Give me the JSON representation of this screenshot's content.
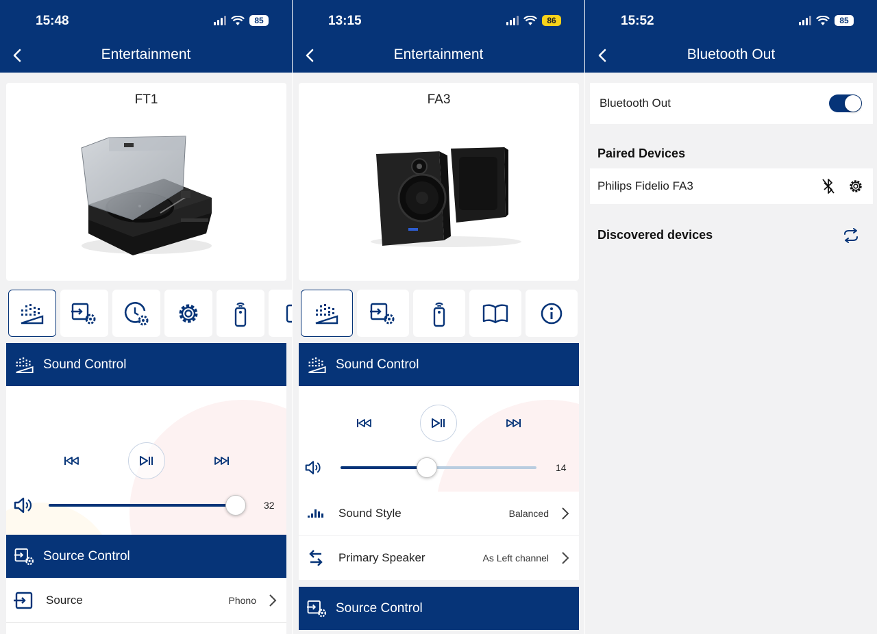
{
  "screens": [
    {
      "status": {
        "time": "15:48",
        "battery": "85"
      },
      "header": {
        "title": "Entertainment"
      },
      "device": {
        "name": "FT1",
        "image": "turntable"
      },
      "tabs": [
        {
          "icon": "sound-control-icon",
          "active": true
        },
        {
          "icon": "source-control-icon",
          "active": false
        },
        {
          "icon": "timer-settings-icon",
          "active": false
        },
        {
          "icon": "gear-icon",
          "active": false
        },
        {
          "icon": "remote-icon",
          "active": false
        },
        {
          "icon": "more-icon",
          "active": false
        }
      ],
      "sound_control": {
        "title": "Sound Control",
        "volume": "32",
        "volume_level": 1.0
      },
      "source_control": {
        "title": "Source Control"
      },
      "source_row": {
        "label": "Source",
        "value": "Phono"
      }
    },
    {
      "status": {
        "time": "13:15",
        "battery": "86"
      },
      "header": {
        "title": "Entertainment"
      },
      "device": {
        "name": "FA3",
        "image": "speakers"
      },
      "tabs": [
        {
          "icon": "sound-control-icon",
          "active": true
        },
        {
          "icon": "source-control-icon",
          "active": false
        },
        {
          "icon": "remote-icon",
          "active": false
        },
        {
          "icon": "book-icon",
          "active": false
        },
        {
          "icon": "info-icon",
          "active": false
        }
      ],
      "sound_control": {
        "title": "Sound Control",
        "volume": "14",
        "volume_level": 0.44
      },
      "settings": [
        {
          "icon": "equalizer-icon",
          "label": "Sound Style",
          "value": "Balanced"
        },
        {
          "icon": "swap-icon",
          "label": "Primary Speaker",
          "value": "As Left channel"
        }
      ],
      "source_control": {
        "title": "Source Control"
      }
    },
    {
      "status": {
        "time": "15:52",
        "battery": "85"
      },
      "header": {
        "title": "Bluetooth Out"
      },
      "bluetooth": {
        "label": "Bluetooth Out",
        "enabled": true
      },
      "paired": {
        "title": "Paired Devices",
        "device": "Philips Fidelio FA3"
      },
      "discovered": {
        "title": "Discovered devices"
      }
    }
  ],
  "colors": {
    "primary": "#063478",
    "background": "#f2f2f3",
    "slider_track": "#b9cde0",
    "battery_yellow": "#f7d21a"
  }
}
